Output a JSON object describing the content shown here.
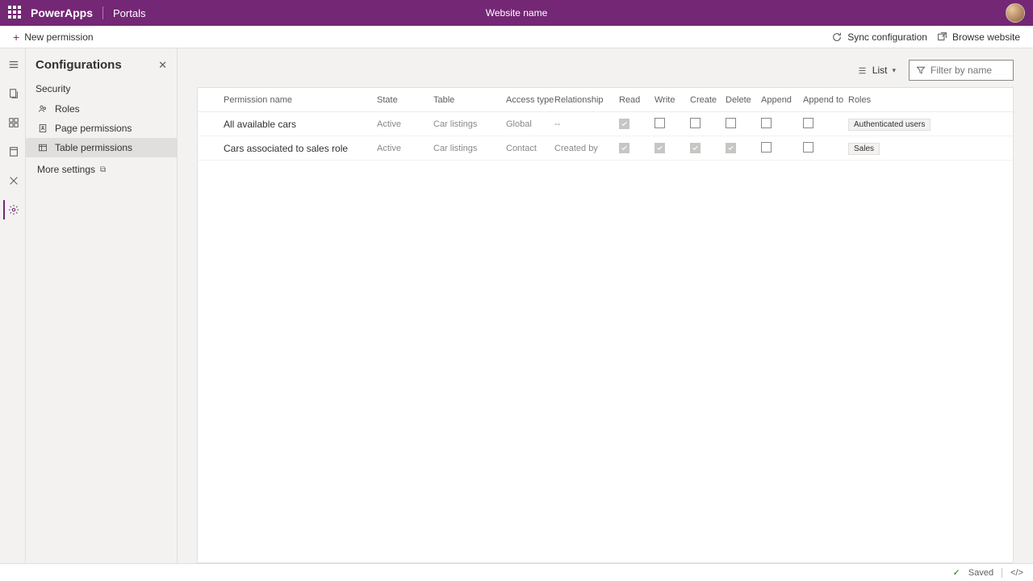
{
  "topbar": {
    "brand": "PowerApps",
    "sub": "Portals",
    "site": "Website name"
  },
  "cmdbar": {
    "new": "New permission",
    "sync": "Sync configuration",
    "browse": "Browse website"
  },
  "panel": {
    "title": "Configurations",
    "section": "Security",
    "items": [
      {
        "label": "Roles"
      },
      {
        "label": "Page permissions"
      },
      {
        "label": "Table permissions",
        "selected": true
      }
    ],
    "more": "More settings"
  },
  "toolbar": {
    "view": "List",
    "filter_placeholder": "Filter by name"
  },
  "columns": {
    "name": "Permission name",
    "state": "State",
    "table": "Table",
    "access": "Access type",
    "rel": "Relationship",
    "read": "Read",
    "write": "Write",
    "create": "Create",
    "delete": "Delete",
    "append": "Append",
    "appendto": "Append to",
    "roles": "Roles"
  },
  "rows": [
    {
      "name": "All available cars",
      "state": "Active",
      "table": "Car listings",
      "access": "Global",
      "rel": "--",
      "perm": {
        "read": true,
        "write": false,
        "create": false,
        "delete": false,
        "append": false,
        "appendto": false
      },
      "role": "Authenticated users"
    },
    {
      "name": "Cars associated to sales role",
      "state": "Active",
      "table": "Car listings",
      "access": "Contact",
      "rel": "Created by",
      "perm": {
        "read": true,
        "write": true,
        "create": true,
        "delete": true,
        "append": false,
        "appendto": false
      },
      "role": "Sales"
    }
  ],
  "status": {
    "saved": "Saved"
  }
}
